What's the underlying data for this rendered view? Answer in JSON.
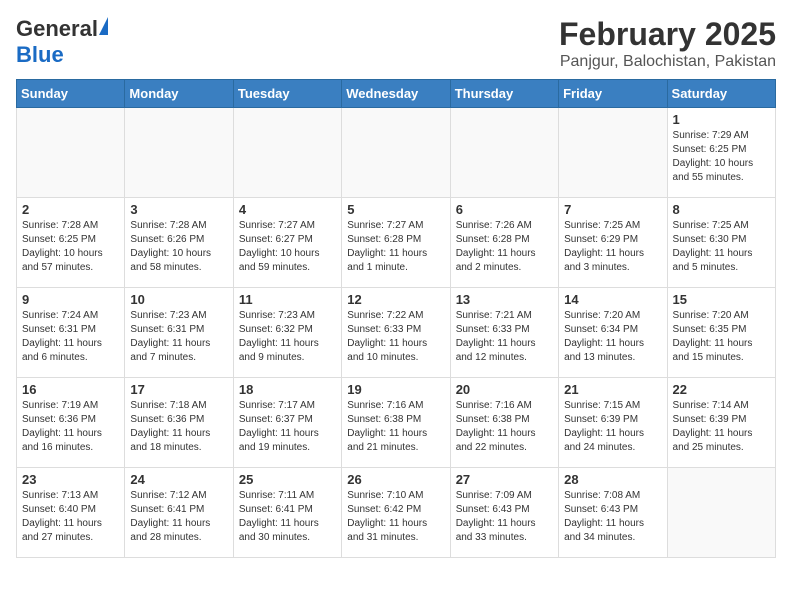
{
  "header": {
    "logo_general": "General",
    "logo_blue": "Blue",
    "month_year": "February 2025",
    "location": "Panjgur, Balochistan, Pakistan"
  },
  "days_of_week": [
    "Sunday",
    "Monday",
    "Tuesday",
    "Wednesday",
    "Thursday",
    "Friday",
    "Saturday"
  ],
  "weeks": [
    [
      {
        "day": "",
        "info": ""
      },
      {
        "day": "",
        "info": ""
      },
      {
        "day": "",
        "info": ""
      },
      {
        "day": "",
        "info": ""
      },
      {
        "day": "",
        "info": ""
      },
      {
        "day": "",
        "info": ""
      },
      {
        "day": "1",
        "info": "Sunrise: 7:29 AM\nSunset: 6:25 PM\nDaylight: 10 hours and 55 minutes."
      }
    ],
    [
      {
        "day": "2",
        "info": "Sunrise: 7:28 AM\nSunset: 6:25 PM\nDaylight: 10 hours and 57 minutes."
      },
      {
        "day": "3",
        "info": "Sunrise: 7:28 AM\nSunset: 6:26 PM\nDaylight: 10 hours and 58 minutes."
      },
      {
        "day": "4",
        "info": "Sunrise: 7:27 AM\nSunset: 6:27 PM\nDaylight: 10 hours and 59 minutes."
      },
      {
        "day": "5",
        "info": "Sunrise: 7:27 AM\nSunset: 6:28 PM\nDaylight: 11 hours and 1 minute."
      },
      {
        "day": "6",
        "info": "Sunrise: 7:26 AM\nSunset: 6:28 PM\nDaylight: 11 hours and 2 minutes."
      },
      {
        "day": "7",
        "info": "Sunrise: 7:25 AM\nSunset: 6:29 PM\nDaylight: 11 hours and 3 minutes."
      },
      {
        "day": "8",
        "info": "Sunrise: 7:25 AM\nSunset: 6:30 PM\nDaylight: 11 hours and 5 minutes."
      }
    ],
    [
      {
        "day": "9",
        "info": "Sunrise: 7:24 AM\nSunset: 6:31 PM\nDaylight: 11 hours and 6 minutes."
      },
      {
        "day": "10",
        "info": "Sunrise: 7:23 AM\nSunset: 6:31 PM\nDaylight: 11 hours and 7 minutes."
      },
      {
        "day": "11",
        "info": "Sunrise: 7:23 AM\nSunset: 6:32 PM\nDaylight: 11 hours and 9 minutes."
      },
      {
        "day": "12",
        "info": "Sunrise: 7:22 AM\nSunset: 6:33 PM\nDaylight: 11 hours and 10 minutes."
      },
      {
        "day": "13",
        "info": "Sunrise: 7:21 AM\nSunset: 6:33 PM\nDaylight: 11 hours and 12 minutes."
      },
      {
        "day": "14",
        "info": "Sunrise: 7:20 AM\nSunset: 6:34 PM\nDaylight: 11 hours and 13 minutes."
      },
      {
        "day": "15",
        "info": "Sunrise: 7:20 AM\nSunset: 6:35 PM\nDaylight: 11 hours and 15 minutes."
      }
    ],
    [
      {
        "day": "16",
        "info": "Sunrise: 7:19 AM\nSunset: 6:36 PM\nDaylight: 11 hours and 16 minutes."
      },
      {
        "day": "17",
        "info": "Sunrise: 7:18 AM\nSunset: 6:36 PM\nDaylight: 11 hours and 18 minutes."
      },
      {
        "day": "18",
        "info": "Sunrise: 7:17 AM\nSunset: 6:37 PM\nDaylight: 11 hours and 19 minutes."
      },
      {
        "day": "19",
        "info": "Sunrise: 7:16 AM\nSunset: 6:38 PM\nDaylight: 11 hours and 21 minutes."
      },
      {
        "day": "20",
        "info": "Sunrise: 7:16 AM\nSunset: 6:38 PM\nDaylight: 11 hours and 22 minutes."
      },
      {
        "day": "21",
        "info": "Sunrise: 7:15 AM\nSunset: 6:39 PM\nDaylight: 11 hours and 24 minutes."
      },
      {
        "day": "22",
        "info": "Sunrise: 7:14 AM\nSunset: 6:39 PM\nDaylight: 11 hours and 25 minutes."
      }
    ],
    [
      {
        "day": "23",
        "info": "Sunrise: 7:13 AM\nSunset: 6:40 PM\nDaylight: 11 hours and 27 minutes."
      },
      {
        "day": "24",
        "info": "Sunrise: 7:12 AM\nSunset: 6:41 PM\nDaylight: 11 hours and 28 minutes."
      },
      {
        "day": "25",
        "info": "Sunrise: 7:11 AM\nSunset: 6:41 PM\nDaylight: 11 hours and 30 minutes."
      },
      {
        "day": "26",
        "info": "Sunrise: 7:10 AM\nSunset: 6:42 PM\nDaylight: 11 hours and 31 minutes."
      },
      {
        "day": "27",
        "info": "Sunrise: 7:09 AM\nSunset: 6:43 PM\nDaylight: 11 hours and 33 minutes."
      },
      {
        "day": "28",
        "info": "Sunrise: 7:08 AM\nSunset: 6:43 PM\nDaylight: 11 hours and 34 minutes."
      },
      {
        "day": "",
        "info": ""
      }
    ]
  ]
}
